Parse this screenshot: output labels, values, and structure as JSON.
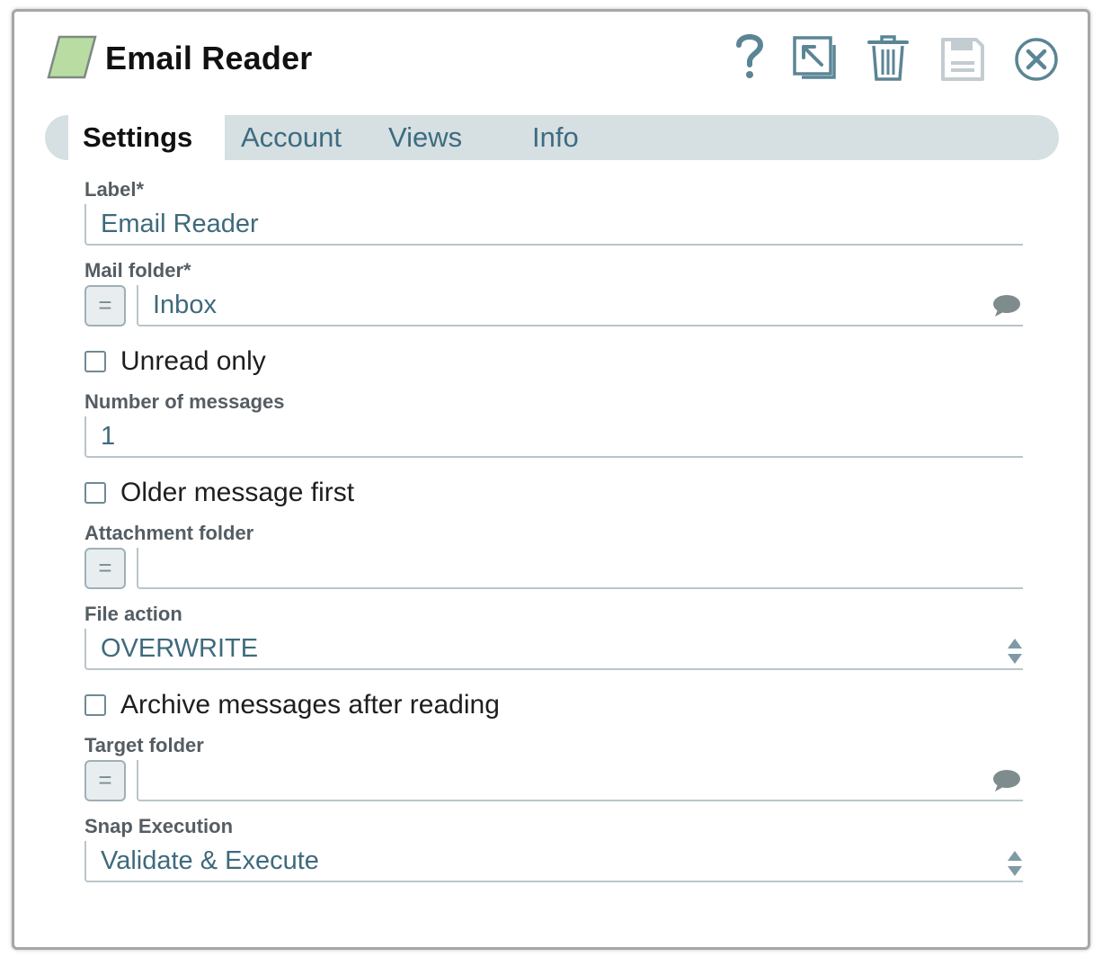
{
  "header": {
    "title": "Email Reader",
    "icons": [
      "help-icon",
      "export-icon",
      "delete-icon",
      "save-icon",
      "close-icon"
    ]
  },
  "tabs": [
    {
      "label": "Settings",
      "active": true
    },
    {
      "label": "Account",
      "active": false
    },
    {
      "label": "Views",
      "active": false
    },
    {
      "label": "Info",
      "active": false
    }
  ],
  "fields": {
    "label": {
      "label": "Label*",
      "value": "Email Reader"
    },
    "mail_folder": {
      "label": "Mail folder*",
      "value": "Inbox",
      "expr_symbol": "="
    },
    "unread_only": {
      "label": "Unread only",
      "checked": false
    },
    "number_of_messages": {
      "label": "Number of messages",
      "value": "1"
    },
    "older_first": {
      "label": "Older message first",
      "checked": false
    },
    "attachment_folder": {
      "label": "Attachment folder",
      "value": "",
      "expr_symbol": "="
    },
    "file_action": {
      "label": "File action",
      "value": "OVERWRITE"
    },
    "archive_after": {
      "label": "Archive messages after reading",
      "checked": false
    },
    "target_folder": {
      "label": "Target folder",
      "value": "",
      "expr_symbol": "="
    },
    "snap_execution": {
      "label": "Snap Execution",
      "value": "Validate & Execute"
    }
  },
  "colors": {
    "accent": "#3d6c80",
    "tab_bar": "#d6dfe2",
    "snap_icon_fill": "#b9dca2",
    "field_border": "#b9c5ca",
    "disabled_icon": "#c3ccd0"
  }
}
